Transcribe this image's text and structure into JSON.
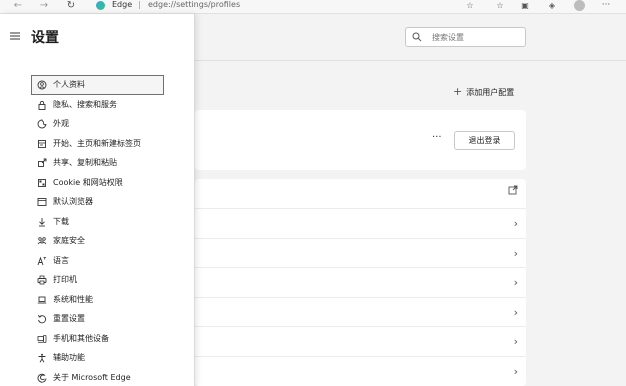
{
  "browser": {
    "brand": "Edge",
    "separator": "|",
    "url": "edge://settings/profiles"
  },
  "settings": {
    "title": "设置",
    "search_placeholder": "搜索设置",
    "nav_items": [
      {
        "label": "个人资料",
        "icon": "profile-icon",
        "active": true
      },
      {
        "label": "隐私、搜索和服务",
        "icon": "lock-icon"
      },
      {
        "label": "外观",
        "icon": "appearance-icon"
      },
      {
        "label": "开始、主页和新建标签页",
        "icon": "home-icon"
      },
      {
        "label": "共享、复制和粘贴",
        "icon": "share-icon"
      },
      {
        "label": "Cookie 和网站权限",
        "icon": "site-permissions-icon"
      },
      {
        "label": "默认浏览器",
        "icon": "browser-icon"
      },
      {
        "label": "下载",
        "icon": "download-icon"
      },
      {
        "label": "家庭安全",
        "icon": "family-icon"
      },
      {
        "label": "语言",
        "icon": "language-icon"
      },
      {
        "label": "打印机",
        "icon": "printer-icon"
      },
      {
        "label": "系统和性能",
        "icon": "laptop-icon"
      },
      {
        "label": "重置设置",
        "icon": "reset-icon"
      },
      {
        "label": "手机和其他设备",
        "icon": "phone-icon"
      },
      {
        "label": "辅助功能",
        "icon": "accessibility-icon"
      },
      {
        "label": "关于 Microsoft Edge",
        "icon": "edge-icon"
      }
    ],
    "add_profile_label": "添加用户配置",
    "more_label": "···",
    "logout_label": "退出登录"
  }
}
